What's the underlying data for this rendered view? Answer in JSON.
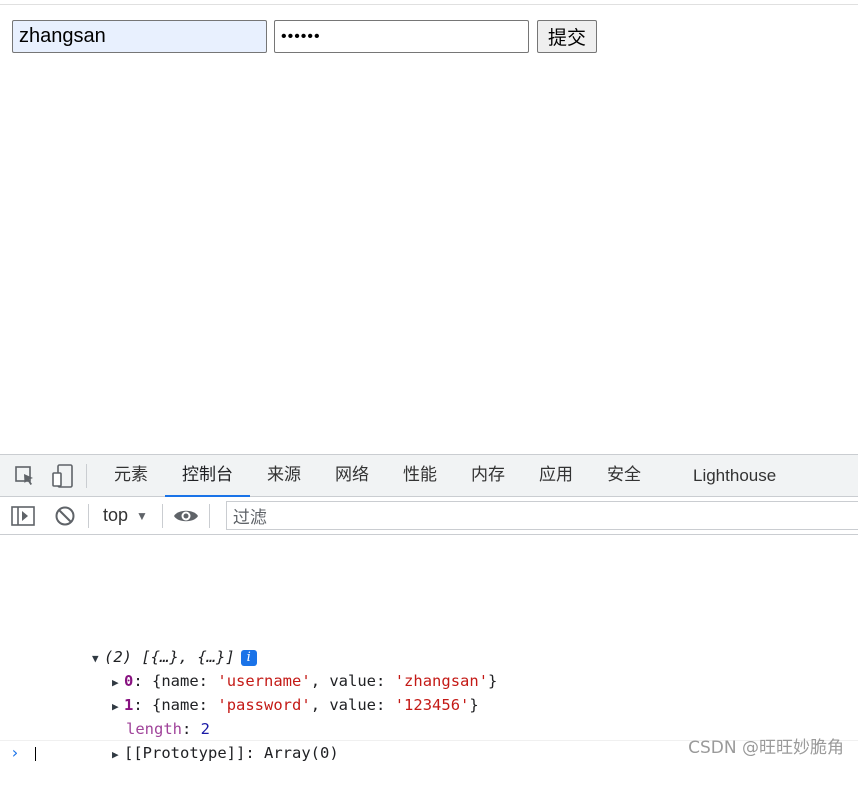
{
  "form": {
    "username_value": "zhangsan",
    "password_value": "••••••",
    "submit_label": "提交"
  },
  "devtools": {
    "tabs": [
      "元素",
      "控制台",
      "来源",
      "网络",
      "性能",
      "内存",
      "应用",
      "安全",
      "Lighthouse"
    ],
    "active_tab": "控制台",
    "context": "top",
    "filter_placeholder": "过滤",
    "console": {
      "summary_count": "(2)",
      "summary_body": "[{…}, {…}]",
      "items": [
        {
          "index": "0",
          "name": "username",
          "value": "zhangsan"
        },
        {
          "index": "1",
          "name": "password",
          "value": "123456"
        }
      ],
      "length_key": "length",
      "length_value": "2",
      "prototype": "[[Prototype]]",
      "prototype_value": "Array(0)"
    }
  },
  "watermark": "CSDN @旺旺妙脆角",
  "accent": "#1a73e8"
}
